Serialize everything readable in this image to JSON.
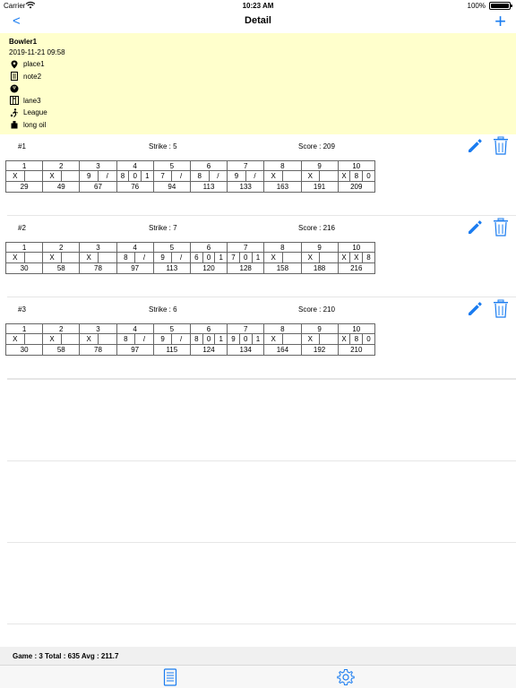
{
  "status_bar": {
    "carrier": "Carrier",
    "time": "10:23 AM",
    "battery": "100%"
  },
  "nav": {
    "back_label": "<",
    "title": "Detail",
    "add_label": "+"
  },
  "info": {
    "bowler": "Bowler1",
    "datetime": "2019-11-21  09:58",
    "place": "place1",
    "note": "note2",
    "ball": "",
    "lane": "lane3",
    "type": "League",
    "oil": "long oil"
  },
  "games": [
    {
      "num": "#1",
      "strike": "Strike : 5",
      "score": "Score : 209",
      "frames": [
        {
          "no": "1",
          "balls": [
            "X",
            ""
          ],
          "total": "29"
        },
        {
          "no": "2",
          "balls": [
            "X",
            ""
          ],
          "total": "49"
        },
        {
          "no": "3",
          "balls": [
            "9",
            "/"
          ],
          "total": "67"
        },
        {
          "no": "4",
          "balls": [
            "8",
            "0",
            "1"
          ],
          "total": "76"
        },
        {
          "no": "5",
          "balls": [
            "7",
            "/"
          ],
          "total": "94"
        },
        {
          "no": "6",
          "balls": [
            "8",
            "/"
          ],
          "total": "113"
        },
        {
          "no": "7",
          "balls": [
            "9",
            "/"
          ],
          "total": "133"
        },
        {
          "no": "8",
          "balls": [
            "X",
            ""
          ],
          "total": "163"
        },
        {
          "no": "9",
          "balls": [
            "X",
            ""
          ],
          "total": "191"
        },
        {
          "no": "10",
          "balls": [
            "X",
            "8",
            "0"
          ],
          "total": "209"
        }
      ]
    },
    {
      "num": "#2",
      "strike": "Strike : 7",
      "score": "Score : 216",
      "frames": [
        {
          "no": "1",
          "balls": [
            "X",
            ""
          ],
          "total": "30"
        },
        {
          "no": "2",
          "balls": [
            "X",
            ""
          ],
          "total": "58"
        },
        {
          "no": "3",
          "balls": [
            "X",
            ""
          ],
          "total": "78"
        },
        {
          "no": "4",
          "balls": [
            "8",
            "/"
          ],
          "total": "97"
        },
        {
          "no": "5",
          "balls": [
            "9",
            "/"
          ],
          "total": "113"
        },
        {
          "no": "6",
          "balls": [
            "6",
            "0",
            "1"
          ],
          "total": "120"
        },
        {
          "no": "7",
          "balls": [
            "7",
            "0",
            "1"
          ],
          "total": "128"
        },
        {
          "no": "8",
          "balls": [
            "X",
            ""
          ],
          "total": "158"
        },
        {
          "no": "9",
          "balls": [
            "X",
            ""
          ],
          "total": "188"
        },
        {
          "no": "10",
          "balls": [
            "X",
            "X",
            "8"
          ],
          "total": "216"
        }
      ]
    },
    {
      "num": "#3",
      "strike": "Strike : 6",
      "score": "Score : 210",
      "frames": [
        {
          "no": "1",
          "balls": [
            "X",
            ""
          ],
          "total": "30"
        },
        {
          "no": "2",
          "balls": [
            "X",
            ""
          ],
          "total": "58"
        },
        {
          "no": "3",
          "balls": [
            "X",
            ""
          ],
          "total": "78"
        },
        {
          "no": "4",
          "balls": [
            "8",
            "/"
          ],
          "total": "97"
        },
        {
          "no": "5",
          "balls": [
            "9",
            "/"
          ],
          "total": "115"
        },
        {
          "no": "6",
          "balls": [
            "8",
            "0",
            "1"
          ],
          "total": "124"
        },
        {
          "no": "7",
          "balls": [
            "9",
            "0",
            "1"
          ],
          "total": "134"
        },
        {
          "no": "8",
          "balls": [
            "X",
            ""
          ],
          "total": "164"
        },
        {
          "no": "9",
          "balls": [
            "X",
            ""
          ],
          "total": "192"
        },
        {
          "no": "10",
          "balls": [
            "X",
            "8",
            "0"
          ],
          "total": "210"
        }
      ]
    }
  ],
  "summary": {
    "text": "Game : 3  Total : 635  Avg : 211.7"
  },
  "tabs": {
    "list_icon": "document-list-icon",
    "settings_icon": "gear-icon"
  },
  "colors": {
    "accent": "#1a7cf0",
    "info_bg": "#ffffcc",
    "summary_bg": "#f0f0f0"
  }
}
